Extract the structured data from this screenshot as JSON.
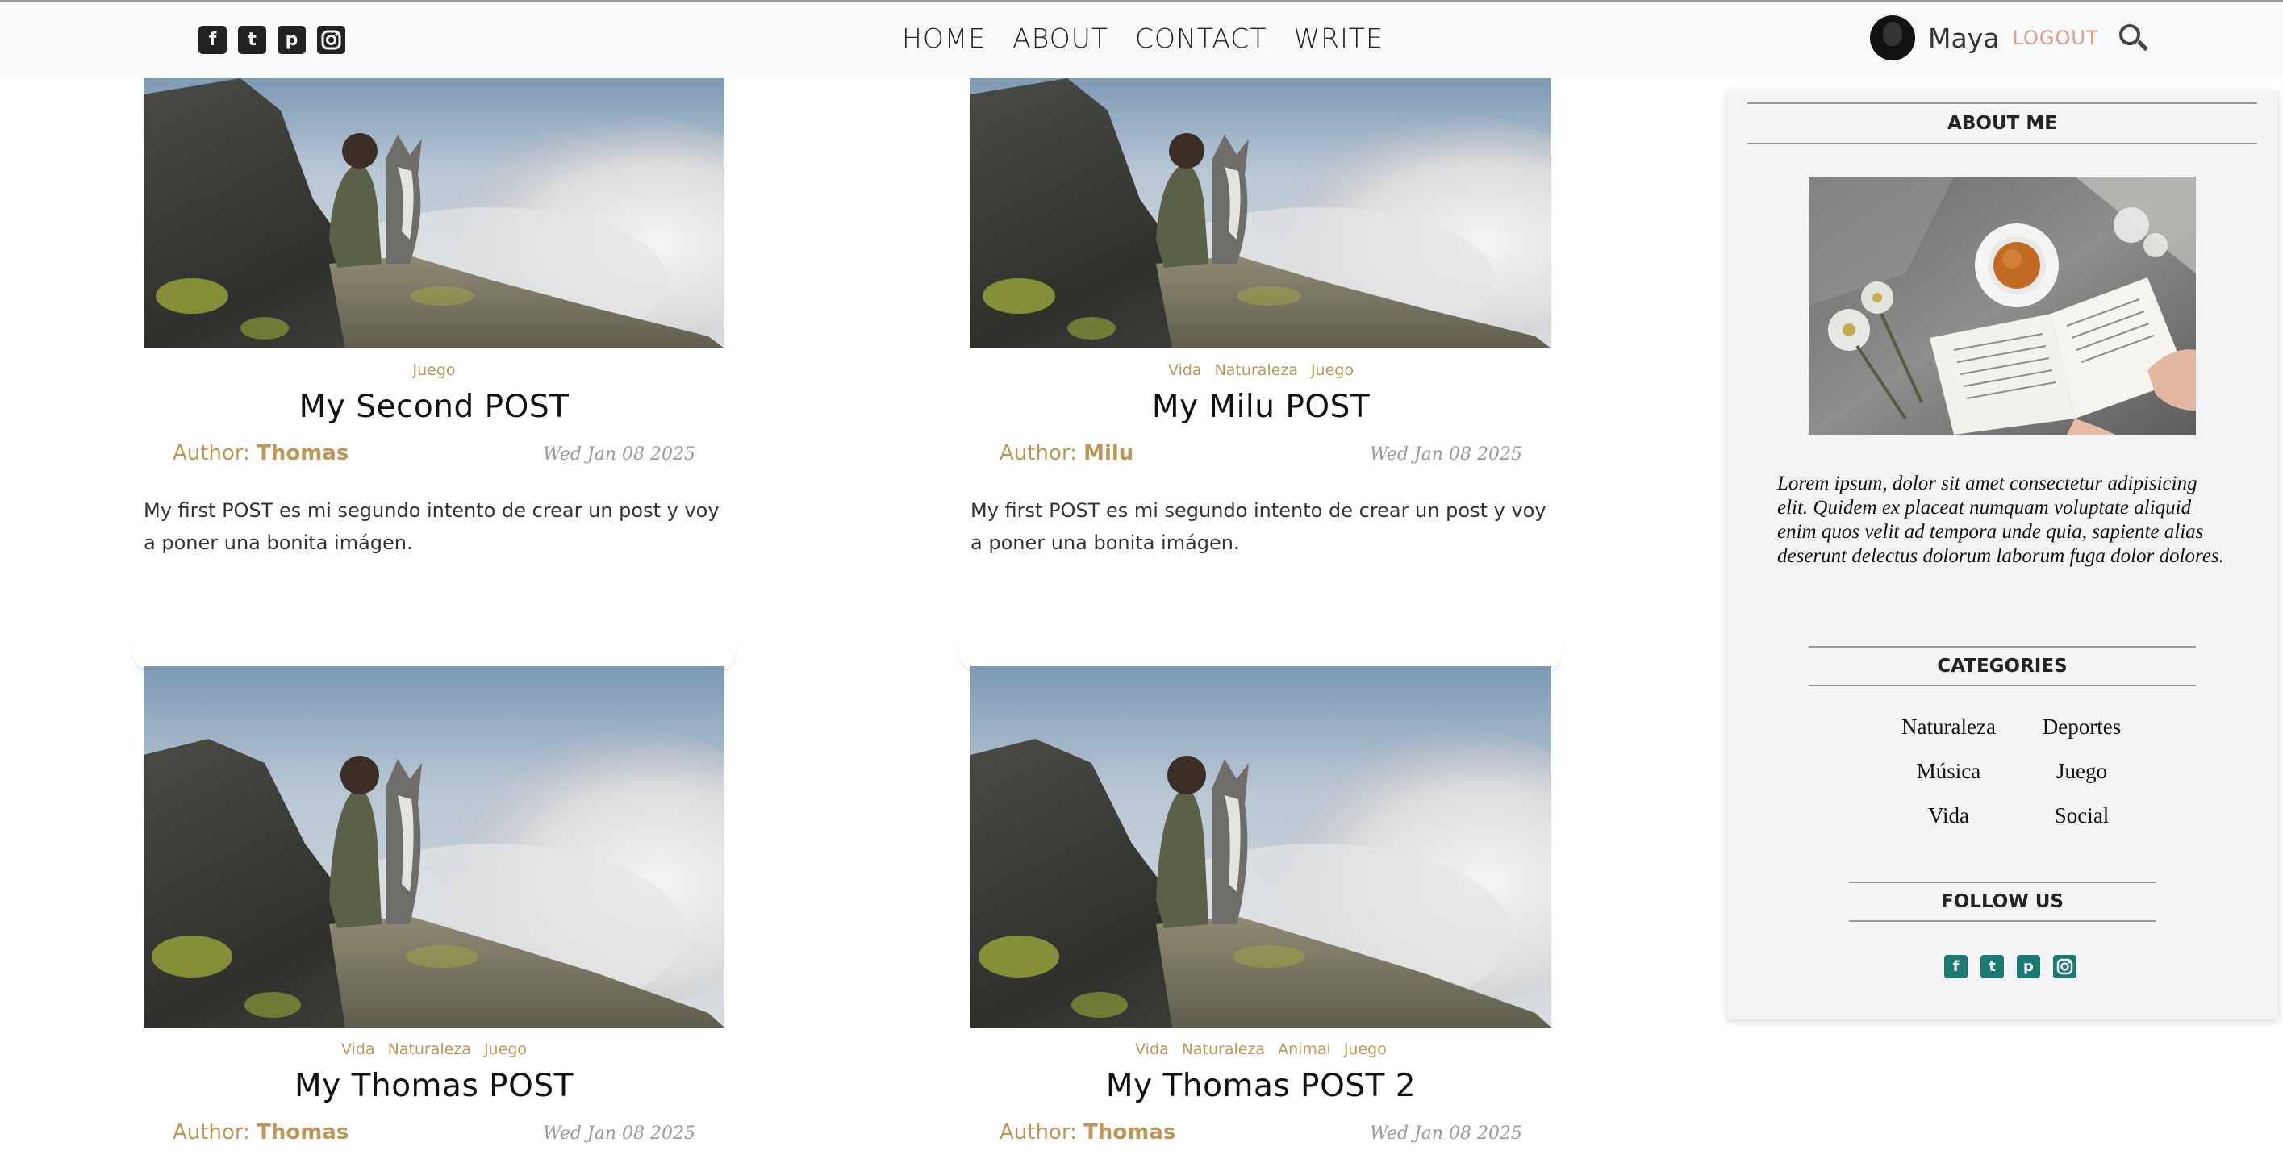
{
  "header": {
    "social_icons": [
      "facebook-square-icon",
      "twitter-square-icon",
      "pinterest-square-icon",
      "instagram-icon"
    ],
    "nav": [
      "HOME",
      "ABOUT",
      "CONTACT",
      "WRITE"
    ],
    "user_name": "Maya",
    "logout_label": "LOGOUT",
    "search_icon": "search-icon"
  },
  "colors": {
    "accent_gold": "#be9656",
    "logout": "#e29a86",
    "social_teal": "#1d7a73",
    "topbar_bg": "#f8f9fa",
    "sidebar_bg": "#f3f4f6"
  },
  "posts": [
    {
      "categories": [
        "Juego"
      ],
      "title": "My Second POST",
      "author_label": "Author: ",
      "author": "Thomas",
      "date": "Wed Jan 08 2025",
      "description": "My first POST es mi segundo intento de crear un post y voy a poner una bonita imágen."
    },
    {
      "categories": [
        "Vida",
        "Naturaleza",
        "Juego"
      ],
      "title": "My Milu POST",
      "author_label": "Author: ",
      "author": "Milu",
      "date": "Wed Jan 08 2025",
      "description": "My first POST es mi segundo intento de crear un post y voy a poner una bonita imágen."
    },
    {
      "categories": [
        "Vida",
        "Naturaleza",
        "Juego"
      ],
      "title": "My Thomas POST",
      "author_label": "Author: ",
      "author": "Thomas",
      "date": "Wed Jan 08 2025"
    },
    {
      "categories": [
        "Vida",
        "Naturaleza",
        "Animal",
        "Juego"
      ],
      "title": "My Thomas POST 2",
      "author_label": "Author: ",
      "author": "Thomas",
      "date": "Wed Jan 08 2025"
    }
  ],
  "sidebar": {
    "about_title": "ABOUT ME",
    "about_text": "Lorem ipsum, dolor sit amet consectetur adipisicing elit. Quidem ex placeat numquam voluptate aliquid enim quos velit ad tempora unde quia, sapiente alias deserunt delectus dolorum laborum fuga dolor dolores.",
    "categories_title": "CATEGORIES",
    "categories": [
      "Naturaleza",
      "Deportes",
      "Música",
      "Juego",
      "Vida",
      "Social"
    ],
    "follow_title": "FOLLOW US",
    "social_icons": [
      "facebook-square-icon",
      "twitter-square-icon",
      "pinterest-square-icon",
      "instagram-icon"
    ]
  }
}
